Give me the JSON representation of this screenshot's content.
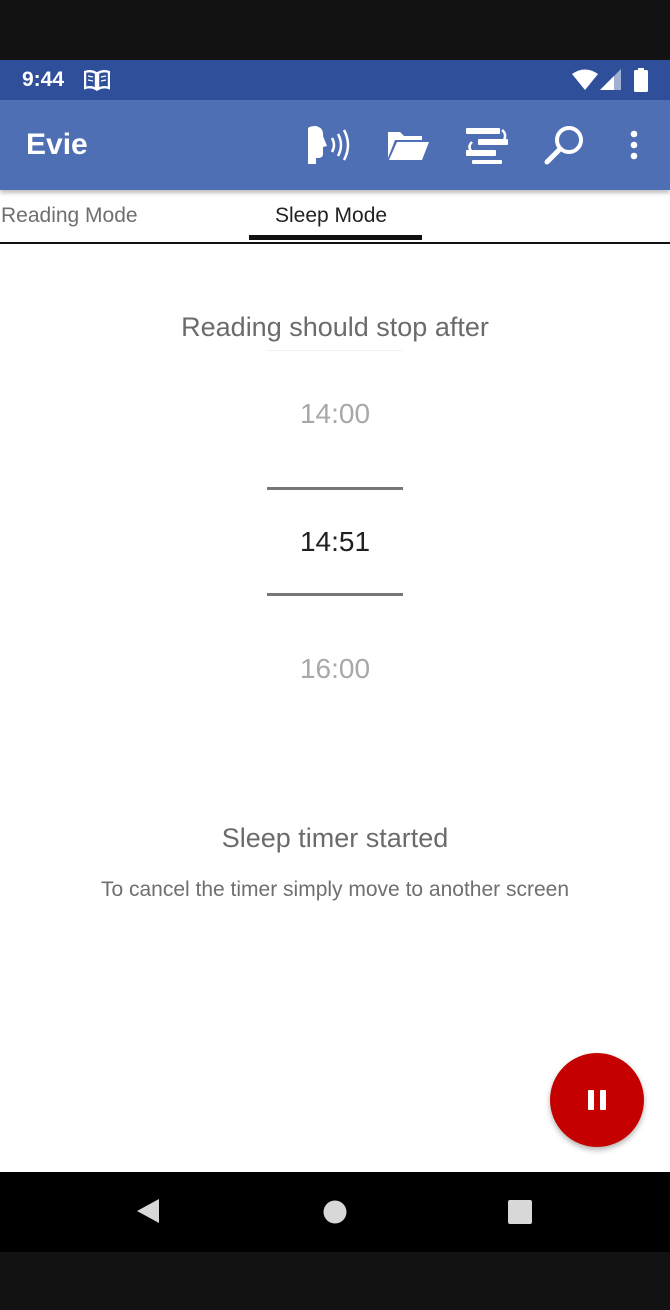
{
  "status_bar": {
    "time": "9:44",
    "icons": [
      "book-icon",
      "wifi-icon",
      "signal-icon",
      "battery-icon"
    ]
  },
  "app_bar": {
    "title": "Evie",
    "actions": [
      "speak-icon",
      "folder-open-icon",
      "text-format-icon",
      "search-icon",
      "more-vert-icon"
    ],
    "color": "#4f6fb4"
  },
  "tabs": [
    {
      "label": "Reading Mode",
      "active": false
    },
    {
      "label": "Sleep Mode",
      "active": true
    }
  ],
  "sleep": {
    "prompt": "Reading should stop after",
    "picker": {
      "previous": "14:00",
      "selected": "14:51",
      "next": "16:00"
    },
    "status_title": "Sleep timer started",
    "status_subtitle": "To cancel the timer simply move to another screen"
  },
  "fab": {
    "icon": "pause-icon",
    "color": "#c40000"
  },
  "nav_bar": {
    "buttons": [
      "back-icon",
      "home-icon",
      "recents-icon"
    ]
  }
}
